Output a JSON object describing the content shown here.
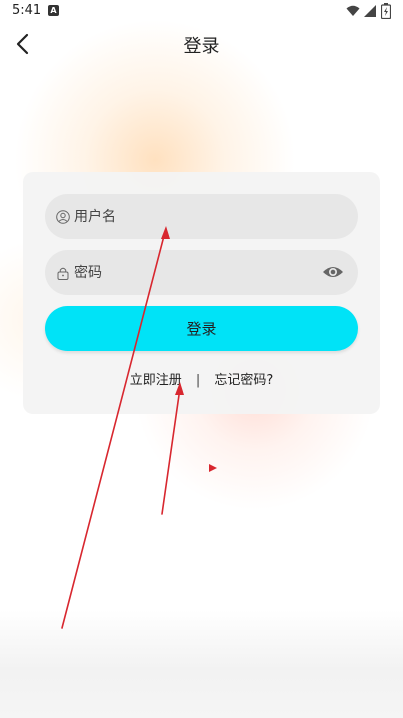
{
  "status_bar": {
    "time": "5:41",
    "notification_letter": "A"
  },
  "app_bar": {
    "title": "登录"
  },
  "login_form": {
    "username_placeholder": "用户名",
    "password_placeholder": "密码",
    "submit_label": "登录",
    "register_link": "立即注册",
    "separator": "|",
    "forgot_link": "忘记密码?"
  },
  "colors": {
    "accent": "#00e3f7",
    "field_bg": "#e7e7e7",
    "card_bg": "#f4f4f4",
    "annotation": "#d8272f"
  }
}
